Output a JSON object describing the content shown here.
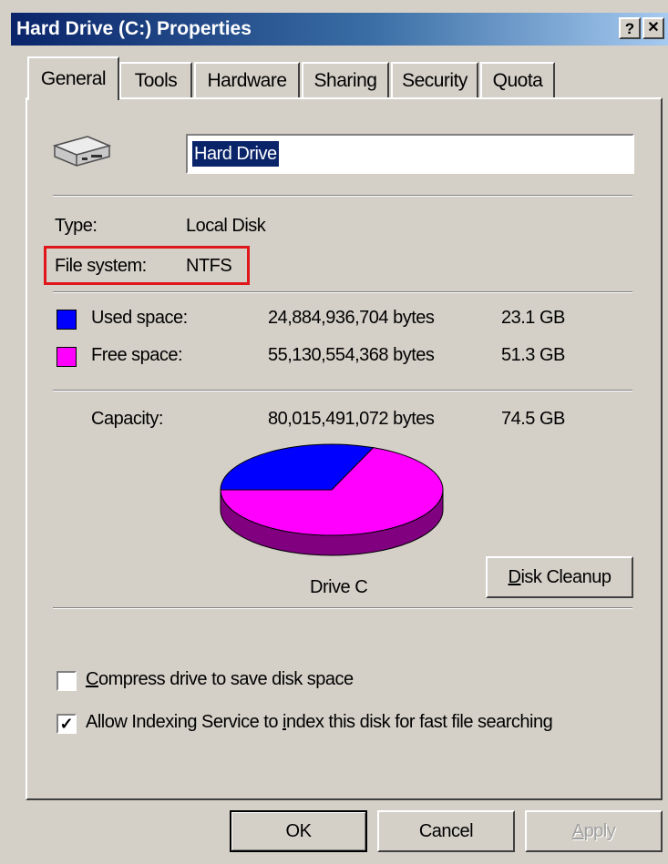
{
  "window": {
    "title": "Hard Drive (C:) Properties",
    "help_button": "?",
    "close_button": "✕"
  },
  "tabs": [
    "General",
    "Tools",
    "Hardware",
    "Sharing",
    "Security",
    "Quota"
  ],
  "active_tab": "General",
  "drive": {
    "icon": "hard-drive-icon",
    "name_value": "Hard Drive",
    "type_label": "Type:",
    "type_value": "Local Disk",
    "fs_label": "File system:",
    "fs_value": "NTFS"
  },
  "space": {
    "used_label": "Used space:",
    "used_bytes": "24,884,936,704 bytes",
    "used_gb": "23.1 GB",
    "free_label": "Free space:",
    "free_bytes": "55,130,554,368 bytes",
    "free_gb": "51.3 GB",
    "capacity_label": "Capacity:",
    "capacity_bytes": "80,015,491,072 bytes",
    "capacity_gb": "74.5 GB",
    "used_color": "#0000ff",
    "free_color": "#ff00ff",
    "free_side_color": "#800080"
  },
  "chart_data": {
    "type": "pie",
    "labels": [
      "Used space",
      "Free space"
    ],
    "values": [
      24884936704,
      55130554368
    ],
    "title": "Drive C"
  },
  "disk_cleanup": {
    "label_rest": "isk Cleanup",
    "mnemonic": "D"
  },
  "options": {
    "compress_label_rest": "ompress drive to save disk space",
    "compress_mnemonic": "C",
    "compress_checked": false,
    "index_label_pre": "Allow Indexing Service to ",
    "index_mnemonic": "i",
    "index_label_post": "ndex this disk for fast file searching",
    "index_checked": true
  },
  "buttons": {
    "ok": "OK",
    "cancel": "Cancel",
    "apply_mnemonic": "A",
    "apply_rest": "pply"
  },
  "annotation": {
    "highlight_color": "#e0161b"
  }
}
